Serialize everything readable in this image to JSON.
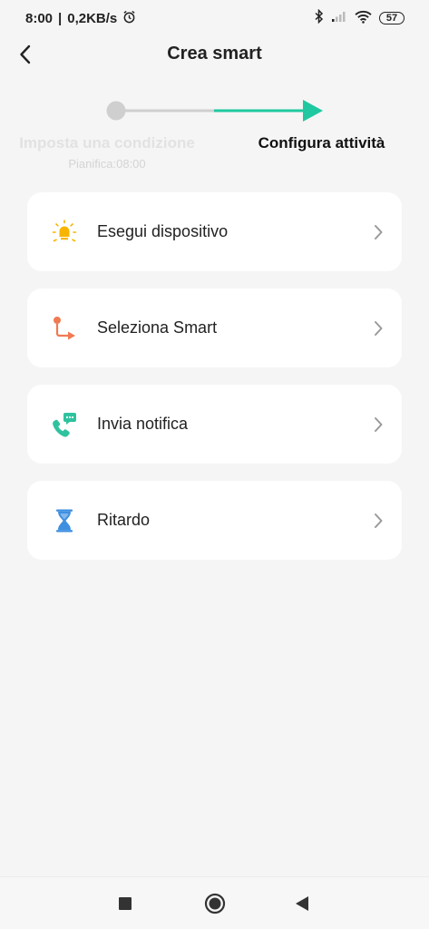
{
  "status_bar": {
    "time": "8:00",
    "separator": "|",
    "speed": "0,2KB/s",
    "battery": "57"
  },
  "header": {
    "title": "Crea smart"
  },
  "stepper": {
    "step1_label": "Imposta una condizione",
    "step1_sub": "Pianifica:08:00",
    "step2_label": "Configura attività",
    "accent_color": "#1fc8a0"
  },
  "actions": [
    {
      "label": "Esegui dispositivo",
      "icon": "bulb-icon",
      "color": "#f7b500"
    },
    {
      "label": "Seleziona Smart",
      "icon": "route-icon",
      "color": "#f07a52"
    },
    {
      "label": "Invia notifica",
      "icon": "phone-message-icon",
      "color": "#2fc29e"
    },
    {
      "label": "Ritardo",
      "icon": "hourglass-icon",
      "color": "#3f8fe0"
    }
  ]
}
